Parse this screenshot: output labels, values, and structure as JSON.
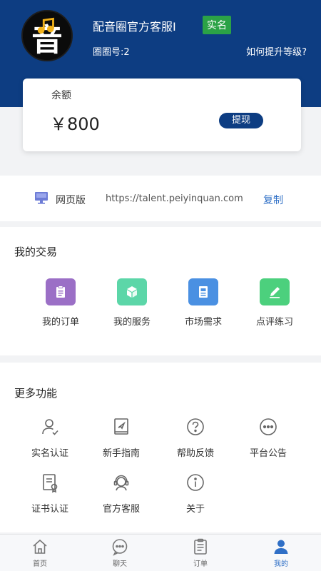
{
  "header": {
    "username": "配音圈官方客服I",
    "verified_badge": "实名",
    "circle_id": "圈圈号:2",
    "upgrade_link": "如何提升等级?",
    "avatar_char": "音",
    "bg_color": "#0d3d82"
  },
  "balance": {
    "label": "余额",
    "value": "￥800",
    "withdraw_label": "提现"
  },
  "web": {
    "label": "网页版",
    "url": "https://talent.peiyinquan.com",
    "copy_label": "复制"
  },
  "trade": {
    "title": "我的交易",
    "items": [
      {
        "label": "我的订单",
        "icon": "clipboard-icon",
        "color": "#9b6fc6"
      },
      {
        "label": "我的服务",
        "icon": "cube-icon",
        "color": "#5cd6a8"
      },
      {
        "label": "市场需求",
        "icon": "document-icon",
        "color": "#4a90e2"
      },
      {
        "label": "点评练习",
        "icon": "pencil-icon",
        "color": "#4cd07d"
      }
    ]
  },
  "more": {
    "title": "更多功能",
    "items": [
      {
        "label": "实名认证",
        "icon": "user-check-icon"
      },
      {
        "label": "新手指南",
        "icon": "guide-book-icon"
      },
      {
        "label": "帮助反馈",
        "icon": "question-circle-icon"
      },
      {
        "label": "平台公告",
        "icon": "ellipsis-circle-icon"
      },
      {
        "label": "证书认证",
        "icon": "certificate-icon"
      },
      {
        "label": "官方客服",
        "icon": "headset-icon"
      },
      {
        "label": "关于",
        "icon": "info-circle-icon"
      }
    ]
  },
  "tabs": [
    {
      "label": "首页",
      "icon": "home-icon"
    },
    {
      "label": "聊天",
      "icon": "chat-icon"
    },
    {
      "label": "订单",
      "icon": "order-list-icon"
    },
    {
      "label": "我的",
      "icon": "profile-icon",
      "active": true
    }
  ],
  "colors": {
    "accent": "#0d3d82",
    "link": "#2f6fc6",
    "verified": "#2ba246"
  }
}
